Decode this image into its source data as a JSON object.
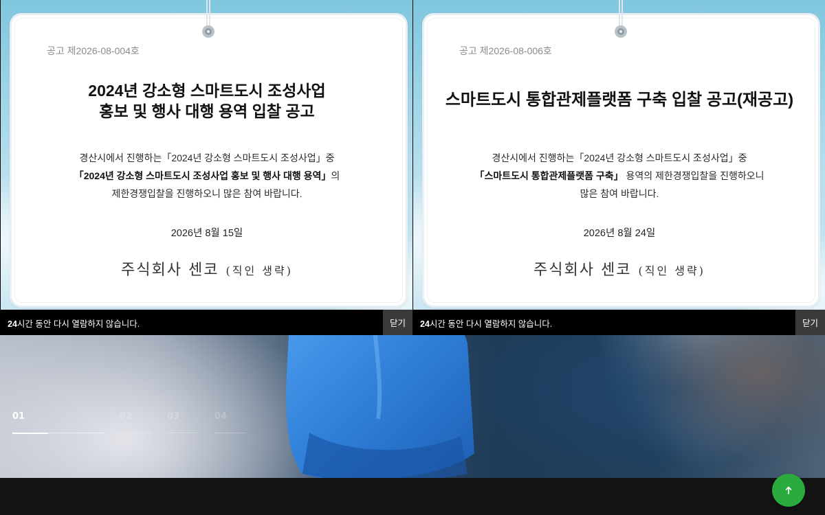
{
  "popups": [
    {
      "notice_no": "공고 제2026-08-004호",
      "title_lines": [
        "2024년 강소형 스마트도시 조성사업",
        "홍보 및 행사 대행 용역 입찰 공고"
      ],
      "body": {
        "line1": "경산시에서 진행하는「2024년 강소형 스마트도시 조성사업」중",
        "line2_bold": "「2024년 강소형 스마트도시 조성사업 홍보 및 행사 대행 용역」",
        "line2_rest": "의",
        "line3": "제한경쟁입찰을 진행하오니 많은 참여 바랍니다."
      },
      "date": "2026년 8월 15일",
      "company": "주식회사 센코",
      "seal_note": "(직인 생략)",
      "no_show_prefix": "24",
      "no_show_rest": "시간 동안 다시 열람하지 않습니다.",
      "close_label": "닫기"
    },
    {
      "notice_no": "공고 제2026-08-006호",
      "title_lines": [
        "스마트도시 통합관제플랫폼 구축 입찰 공고(재공고)"
      ],
      "body": {
        "line1": "경산시에서 진행하는「2024년 강소형 스마트도시 조성사업」중",
        "line2_bold": "「스마트도시 통합관제플랫폼 구축」",
        "line2_rest": " 용역의 제한경쟁입찰을 진행하오니",
        "line3": "많은 참여 바랍니다."
      },
      "date": "2026년 8월 24일",
      "company": "주식회사 센코",
      "seal_note": "(직인 생략)",
      "no_show_prefix": "24",
      "no_show_rest": "시간 동안 다시 열람하지 않습니다.",
      "close_label": "닫기"
    }
  ],
  "slider": {
    "items": [
      {
        "num": "01",
        "active": true
      },
      {
        "num": "02",
        "active": false
      },
      {
        "num": "03",
        "active": false
      },
      {
        "num": "04",
        "active": false
      }
    ]
  },
  "top_button": {
    "icon": "arrow-up-icon"
  },
  "colors": {
    "top_button": "#2bab3e",
    "popup_footer": "#000000",
    "close_button": "#3a3a3a",
    "glove": "#2f7fd8"
  }
}
